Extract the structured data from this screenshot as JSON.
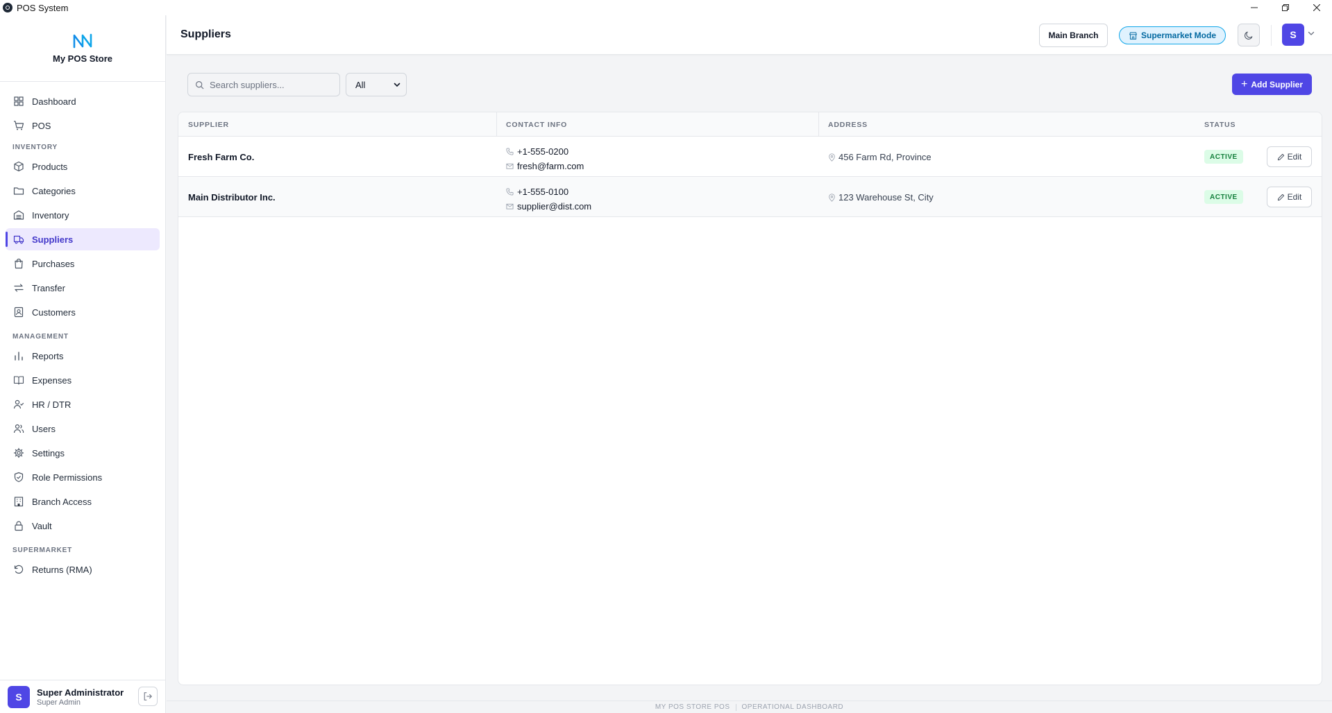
{
  "window": {
    "title": "POS System",
    "controls": [
      "minimize",
      "restore",
      "close"
    ]
  },
  "brand": {
    "name": "My POS Store"
  },
  "nav": {
    "top": [
      {
        "label": "Dashboard",
        "icon": "dashboard-icon"
      },
      {
        "label": "POS",
        "icon": "cart-icon"
      }
    ],
    "sections": [
      {
        "title": "INVENTORY",
        "items": [
          "Products",
          "Categories",
          "Inventory",
          "Suppliers",
          "Purchases",
          "Transfer",
          "Customers"
        ]
      },
      {
        "title": "MANAGEMENT",
        "items": [
          "Reports",
          "Expenses",
          "HR / DTR",
          "Users",
          "Settings",
          "Role Permissions",
          "Branch Access",
          "Vault"
        ]
      },
      {
        "title": "SUPERMARKET",
        "items": [
          "Returns (RMA)"
        ]
      }
    ],
    "active": "Suppliers"
  },
  "user": {
    "initial": "S",
    "name": "Super Administrator",
    "role": "Super Admin"
  },
  "header": {
    "title": "Suppliers",
    "branch_label": "Main Branch",
    "mode_label": "Supermarket Mode",
    "avatar_initial": "S"
  },
  "toolbar": {
    "search_placeholder": "Search suppliers...",
    "filter_selected": "All",
    "add_label": "Add Supplier"
  },
  "table": {
    "columns": [
      "SUPPLIER",
      "CONTACT INFO",
      "ADDRESS",
      "STATUS"
    ],
    "rows": [
      {
        "name": "Fresh Farm Co.",
        "phone": "+1-555-0200",
        "email": "fresh@farm.com",
        "address": "456 Farm Rd, Province",
        "status": "ACTIVE",
        "action": "Edit"
      },
      {
        "name": "Main Distributor Inc.",
        "phone": "+1-555-0100",
        "email": "supplier@dist.com",
        "address": "123 Warehouse St, City",
        "status": "ACTIVE",
        "action": "Edit"
      }
    ]
  },
  "footer": {
    "left": "MY POS STORE POS",
    "right": "OPERATIONAL DASHBOARD"
  },
  "colors": {
    "accent": "#4f46e5",
    "active_bg": "#ede9fe",
    "status_green": "#15803d",
    "mode_blue": "#0369a1"
  }
}
